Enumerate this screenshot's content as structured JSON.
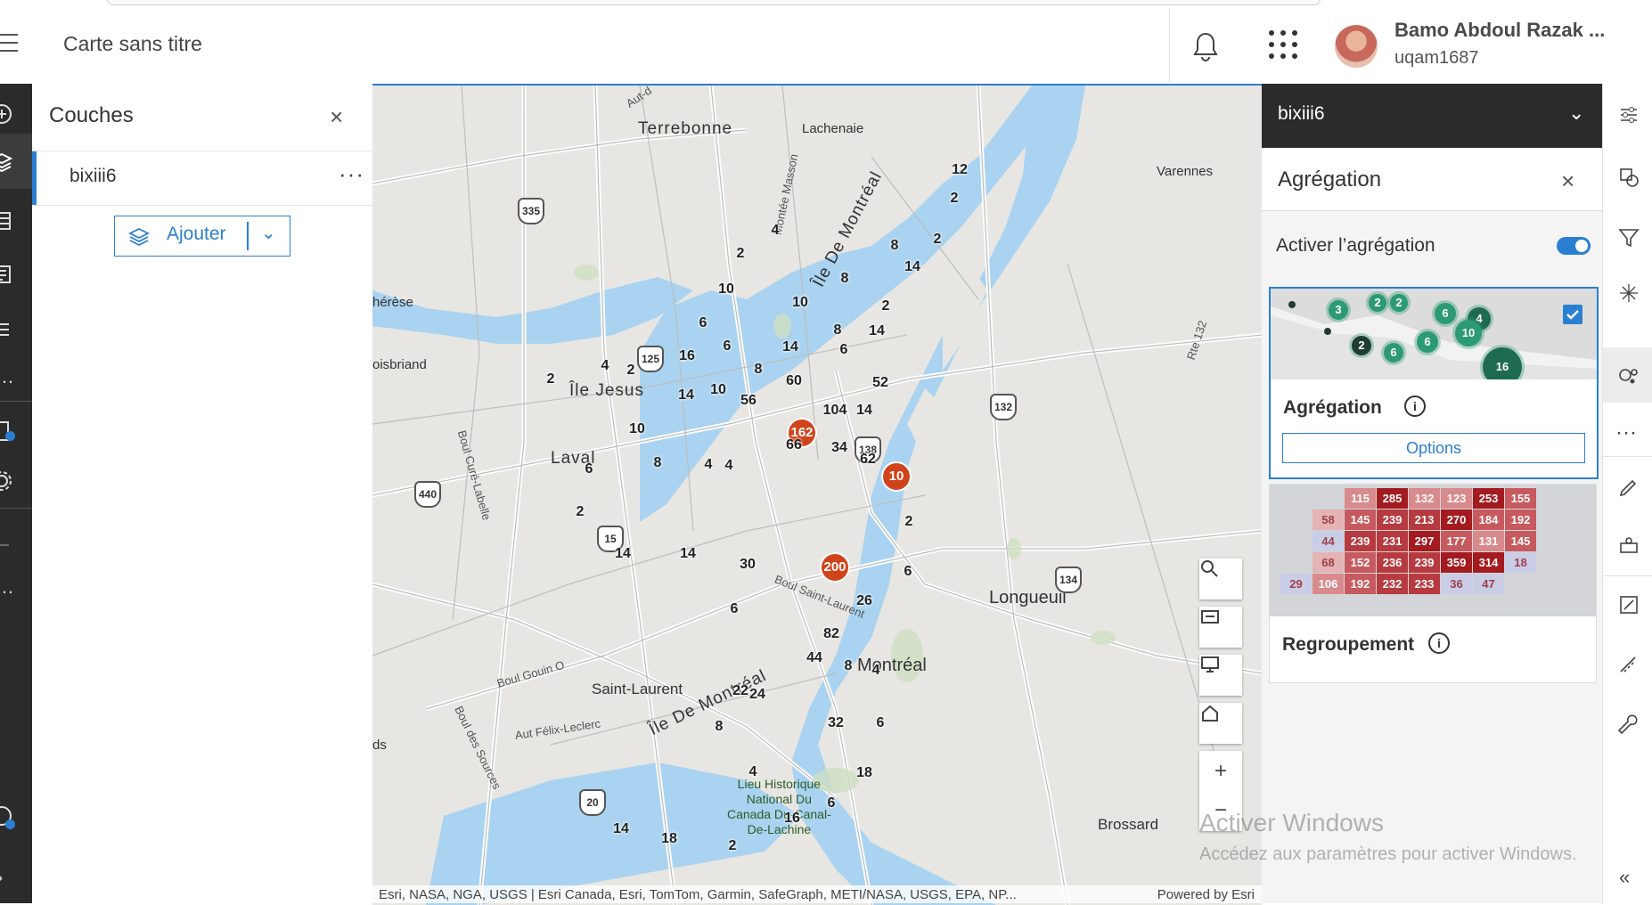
{
  "topbar": {
    "map_title": "Carte sans titre",
    "user_name": "Bamo Abdoul Razak ...",
    "user_id": "uqam1687",
    "icons": [
      "menu-icon",
      "bell-icon",
      "apps-grid-icon",
      "avatar"
    ]
  },
  "layers_panel": {
    "title": "Couches",
    "layer_name": "bixiii6",
    "add_label": "Ajouter"
  },
  "map": {
    "places": [
      "Terrebonne",
      "Lachenaie",
      "Varennes",
      "hérèse",
      "oisbriand",
      "Île Jesus",
      "Laval",
      "Île De Montréal",
      "Saint-Laurent",
      "Longueuil",
      "Montréal",
      "Brossard",
      "ds"
    ],
    "roads": [
      "Boul Curé-Labelle",
      "Montée Masson",
      "Boul Saint-Laurent",
      "Boul Gouin O",
      "Boul des Sources",
      "Aut Félix-Leclerc",
      "Rte 132",
      "Aut-d"
    ],
    "park": [
      "Lieu Historique",
      "National Du",
      "Canada Du-Canal-",
      "De-Lachine"
    ],
    "highway_shields": [
      "335",
      "125",
      "132",
      "138",
      "440",
      "15",
      "20",
      "134"
    ],
    "cluster_counts": [
      "12",
      "2",
      "4",
      "2",
      "8",
      "2",
      "14",
      "8",
      "10",
      "10",
      "2",
      "8",
      "14",
      "6",
      "6",
      "16",
      "14",
      "6",
      "4",
      "2",
      "2",
      "14",
      "10",
      "8",
      "60",
      "52",
      "56",
      "104",
      "14",
      "162",
      "66",
      "34",
      "62",
      "10",
      "2",
      "6",
      "2",
      "10",
      "8",
      "4",
      "4",
      "14",
      "200",
      "6",
      "14",
      "30",
      "26",
      "6",
      "82",
      "44",
      "8",
      "4",
      "22",
      "24",
      "32",
      "6",
      "18",
      "8",
      "4",
      "6",
      "16",
      "14",
      "18",
      "2"
    ],
    "attribution": "Esri, NASA, NGA, USGS | Esri Canada, Esri, TomTom, Garmin, SafeGraph, METI/NASA, USGS, EPA, NP...",
    "powered_by": "Powered by Esri",
    "tool_icons": [
      "search-icon",
      "map-print-icon",
      "screen-icon",
      "home-icon",
      "zoom-in-icon",
      "zoom-out-icon"
    ]
  },
  "right_panel": {
    "layer_select": "bixiii6",
    "section_title": "Agrégation",
    "toggle_label": "Activer l’agrégation",
    "toggle_on": true,
    "card1": {
      "label": "Agrégation",
      "options_label": "Options",
      "checked": true,
      "thumb_counts": [
        "3",
        "2",
        "2",
        "6",
        "4",
        "10",
        "2",
        "6",
        "6",
        "16"
      ]
    },
    "card2": {
      "label": "Regroupement",
      "heat_rows": [
        [
          "115",
          "285",
          "132",
          "123",
          "253",
          "155"
        ],
        [
          "58",
          "145",
          "239",
          "213",
          "270",
          "184",
          "192"
        ],
        [
          "44",
          "239",
          "231",
          "297",
          "177",
          "131",
          "145"
        ],
        [
          "68",
          "152",
          "236",
          "239",
          "359",
          "314",
          "18"
        ],
        [
          "29",
          "106",
          "192",
          "232",
          "233",
          "36",
          "47"
        ]
      ]
    },
    "info_icon": "ⓘ"
  },
  "watermark": {
    "line1": "Activer Windows",
    "line2": "Accédez aux paramètres pour activer Windows."
  },
  "colors": {
    "accent": "#2a7fd1",
    "dark": "#2b2b2b",
    "water": "#a9d3f0",
    "cluster_red": "#d0441c"
  }
}
